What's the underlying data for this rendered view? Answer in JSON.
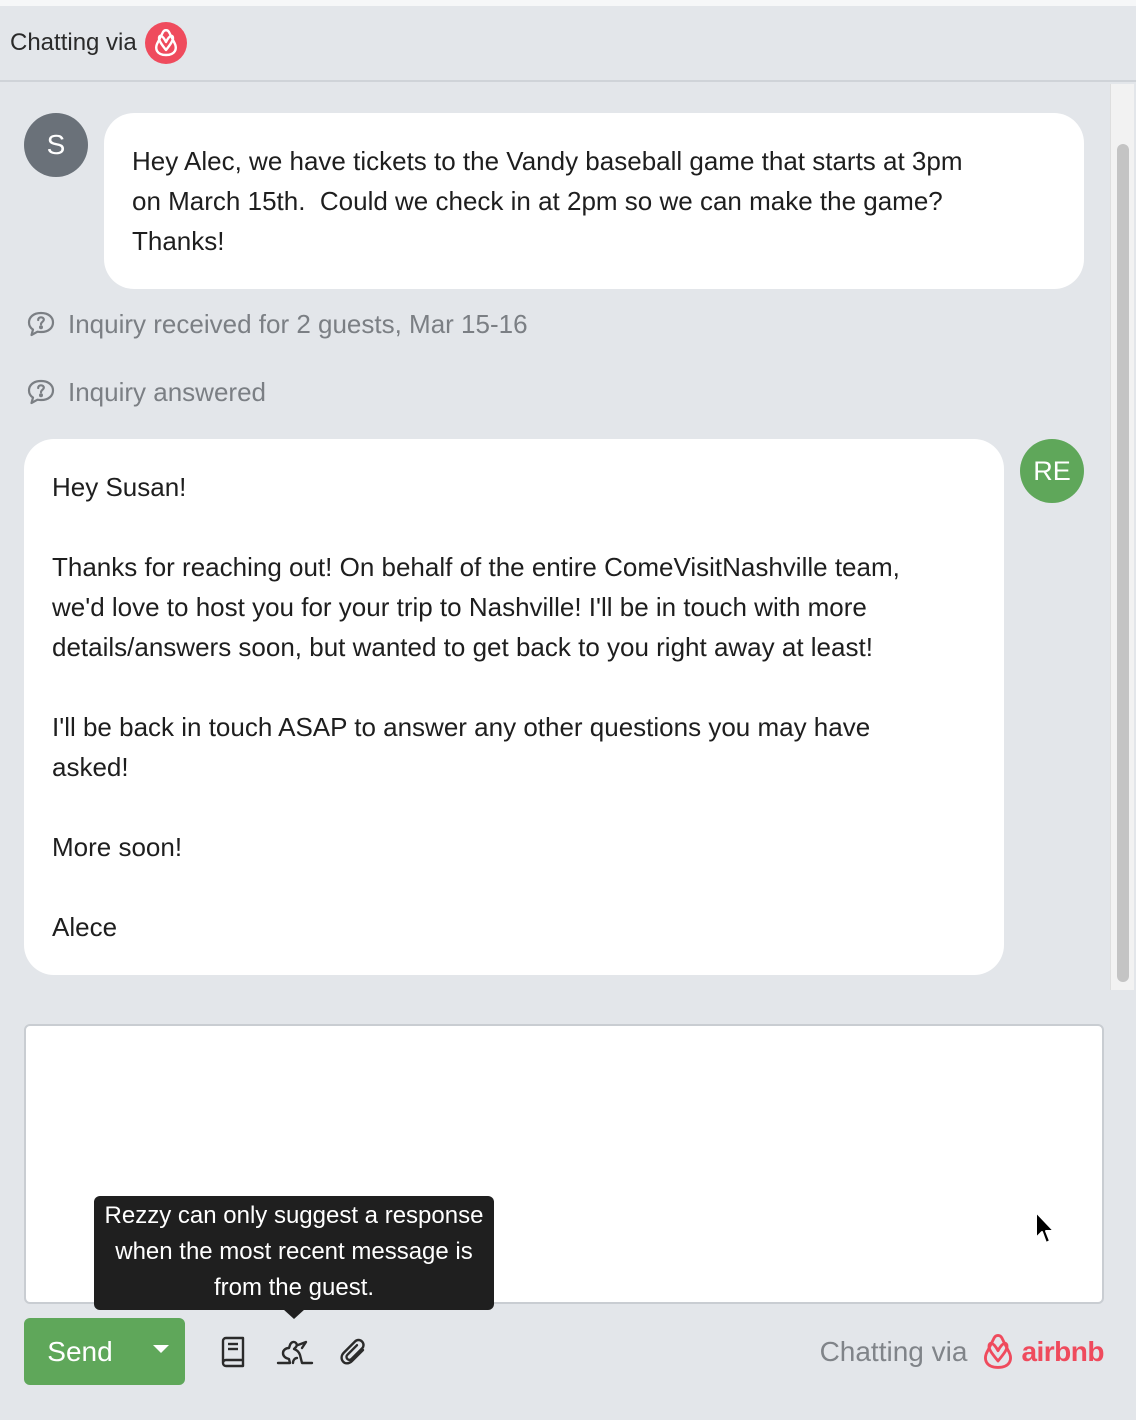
{
  "header": {
    "label": "Chatting via",
    "channel_icon": "airbnb-logo-icon",
    "brand_color": "#ef4b5d"
  },
  "messages": [
    {
      "sender": "guest",
      "avatar_initials": "S",
      "avatar_color": "#6a7179",
      "text": "Hey Alec, we have tickets to the Vandy baseball game that starts at 3pm\non March 15th.  Could we check in at 2pm so we can make the game?\nThanks!"
    },
    {
      "sender": "host",
      "avatar_initials": "RE",
      "avatar_color": "#5fa75a",
      "text": "Hey Susan!\n\nThanks for reaching out! On behalf of the entire ComeVisitNashville team,\nwe'd love to host you for your trip to Nashville! I'll be in touch with more\ndetails/answers soon, but wanted to get back to you right away at least!\n\nI'll be back in touch ASAP to answer any other questions you may have\nasked!\n\nMore soon!\n\nAlece"
    }
  ],
  "events": [
    {
      "icon": "chat-bubble-question-icon",
      "text": "Inquiry received for 2 guests, Mar 15-16"
    },
    {
      "icon": "chat-bubble-question-icon",
      "text": "Inquiry answered"
    }
  ],
  "composer": {
    "value": "",
    "placeholder": ""
  },
  "tooltip": {
    "text": "Rezzy can only suggest a response when the most recent message is from the guest."
  },
  "toolbar": {
    "send_label": "Send",
    "send_color": "#5fa75a",
    "icons": [
      "book-icon",
      "rezzy-icon",
      "paperclip-icon"
    ]
  },
  "footer": {
    "label": "Chatting via",
    "brand": "airbnb"
  }
}
